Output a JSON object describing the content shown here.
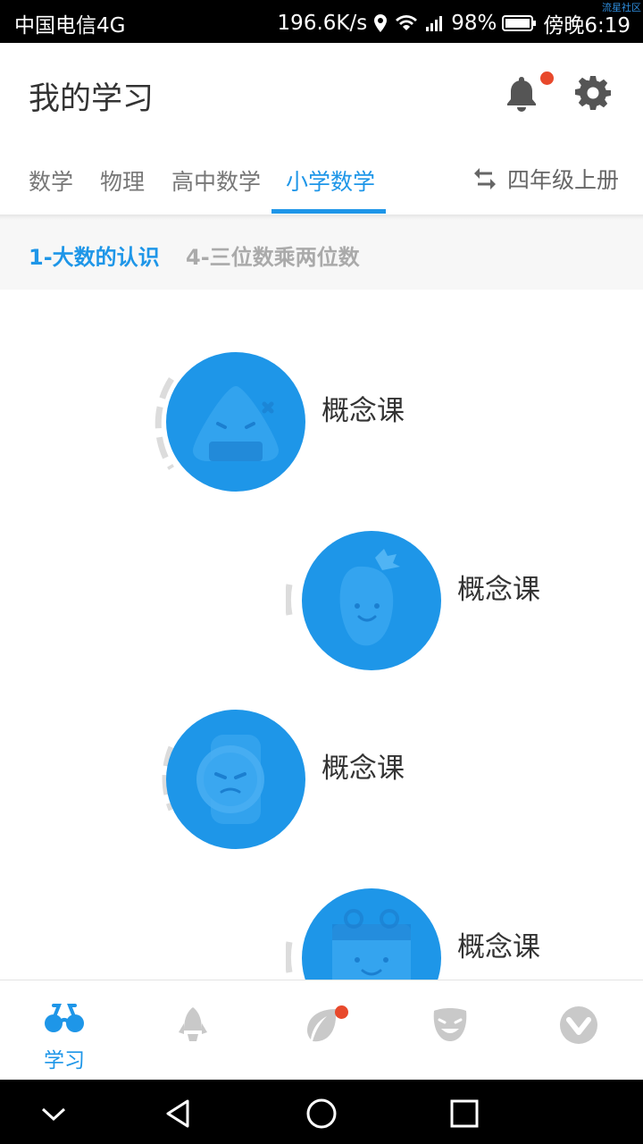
{
  "status_bar": {
    "carrier": "中国电信4G",
    "speed": "196.6K/s",
    "battery": "98%",
    "time": "傍晚6:19",
    "watermark": "流星社区"
  },
  "header": {
    "title": "我的学习"
  },
  "tabs": {
    "items": [
      {
        "label": "数学"
      },
      {
        "label": "物理"
      },
      {
        "label": "高中数学"
      },
      {
        "label": "小学数学"
      }
    ],
    "grade": "四年级上册"
  },
  "units": {
    "items": [
      {
        "label": "1-大数的认识"
      },
      {
        "label": "4-三位数乘两位数"
      }
    ]
  },
  "lessons": [
    {
      "label": "概念课",
      "icon": "onigiri-icon"
    },
    {
      "label": "概念课",
      "icon": "carrot-icon"
    },
    {
      "label": "概念课",
      "icon": "watch-icon"
    },
    {
      "label": "概念课",
      "icon": "calendar-icon"
    }
  ],
  "bottom_nav": {
    "items": [
      {
        "label": "学习",
        "icon": "glasses-icon"
      },
      {
        "label": "",
        "icon": "rocket-icon"
      },
      {
        "label": "",
        "icon": "leaf-icon"
      },
      {
        "label": "",
        "icon": "mask-icon"
      },
      {
        "label": "",
        "icon": "v-badge-icon"
      }
    ]
  },
  "colors": {
    "accent": "#1e96e8",
    "badge": "#e8492c",
    "text": "#333333",
    "muted": "#aaaaaa"
  }
}
